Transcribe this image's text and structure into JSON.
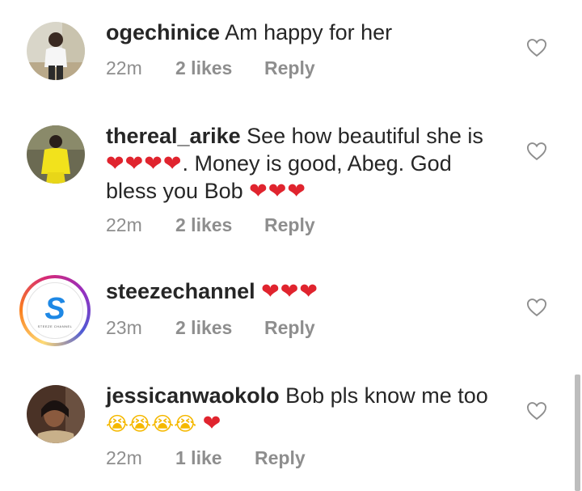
{
  "comments": [
    {
      "username": "ogechinice",
      "text": "Am happy for her",
      "time": "22m",
      "likes": "2 likes",
      "reply": "Reply"
    },
    {
      "username": "thereal_arike",
      "text_line1": "See how beautiful she is",
      "hearts_a": "❤❤❤❤",
      "text_line2": ". Money is good, Abeg.  God",
      "text_line3": "bless you Bob ",
      "hearts_b": "❤❤❤",
      "time": "22m",
      "likes": "2 likes",
      "reply": "Reply"
    },
    {
      "username": "steezechannel",
      "hearts": "❤❤❤",
      "avatar_letter": "S",
      "avatar_caption": "STEEZE CHANNEL",
      "time": "23m",
      "likes": "2 likes",
      "reply": "Reply"
    },
    {
      "username": "jessicanwaokolo",
      "text": "Bob pls know me too",
      "emoji": "😭😭😭😭",
      "hearts": "❤",
      "time": "22m",
      "likes": "1 like",
      "reply": "Reply"
    }
  ],
  "colors": {
    "text": "#262626",
    "meta": "#8e8e8e",
    "heart": "#e0242e",
    "steeze_blue": "#1e88e5"
  },
  "icons": [
    "heart-outline-icon"
  ]
}
